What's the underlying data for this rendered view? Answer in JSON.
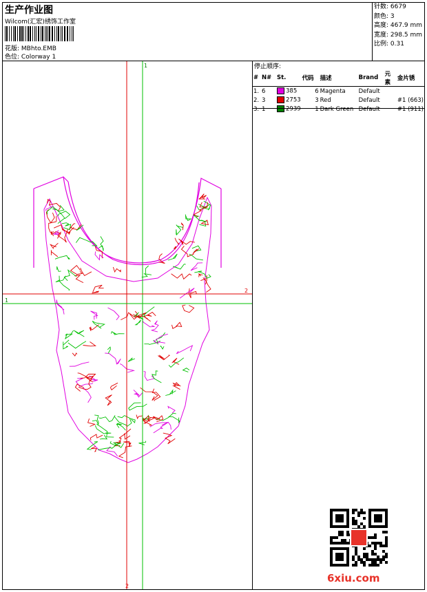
{
  "header": {
    "title": "生产作业图",
    "company": "Wilcom(汇宏)绣饰工作室",
    "design_label": "花版:",
    "design_value": "MBhto.EMB",
    "colorway_label": "色位:",
    "colorway_value": "Colorway 1"
  },
  "stats": {
    "stitches": "针数: 6679",
    "colors": "颜色: 3",
    "height": "高度: 467.9 mm",
    "width": "宽度: 298.5 mm",
    "scale": "比例: 0.31"
  },
  "preview": {
    "guide_v_green": "1",
    "guide_h_green": "1",
    "guide_h_red": "2",
    "guide_v_red": "2"
  },
  "sequence": {
    "title": "停止顺序:",
    "headers": [
      "#",
      "N#",
      "St.",
      "代码",
      "描述",
      "Brand",
      "元素",
      "金片锈"
    ],
    "rows": [
      {
        "idx": "1.",
        "n": "6",
        "color": "#e000e0",
        "st": "385",
        "code": "6",
        "desc": "Magenta",
        "brand": "Default",
        "elem": "",
        "seq": ""
      },
      {
        "idx": "2.",
        "n": "3",
        "color": "#e00000",
        "st": "2753",
        "code": "3",
        "desc": "Red",
        "brand": "Default",
        "elem": "",
        "seq": "#1 (663)"
      },
      {
        "idx": "3.",
        "n": "1",
        "color": "#008000",
        "st": "2939",
        "code": "1",
        "desc": "Dark Green",
        "brand": "Default",
        "elem": "",
        "seq": "#1 (911)"
      }
    ]
  },
  "watermark": "6xiu.com",
  "colors": {
    "magenta": "#e000e0",
    "red": "#e00000",
    "green": "#00c000"
  }
}
